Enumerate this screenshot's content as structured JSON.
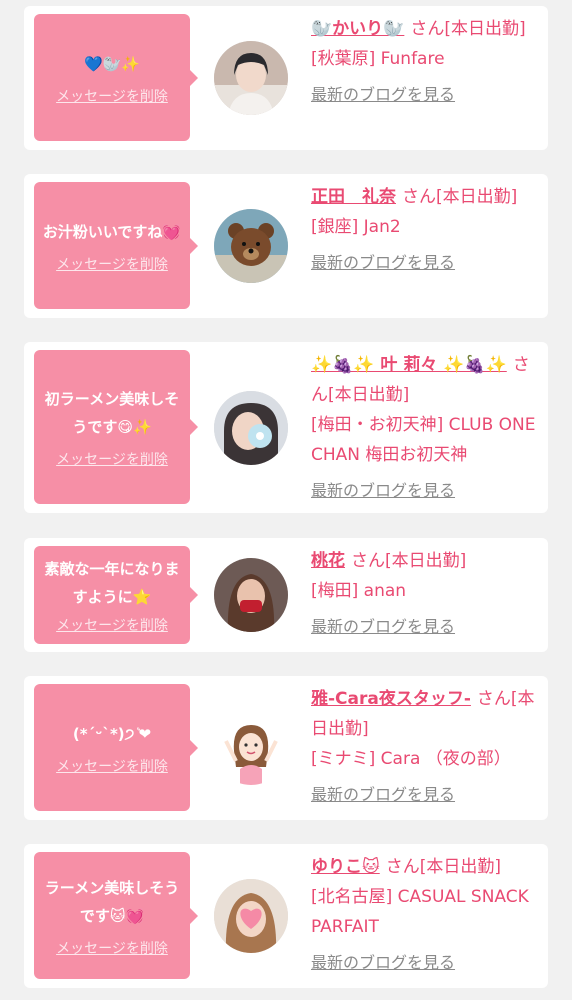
{
  "delete_label": "メッセージを削除",
  "blog_label": "最新のブログを見る",
  "cards": [
    {
      "message": "💙🦭✨",
      "name": "🦭かいり🦭",
      "suffix": "さん[本日出勤]",
      "area": "[秋葉原] Funfare",
      "avatar": "person-icon"
    },
    {
      "message": "お汁粉いいですね💓",
      "name": "正田　礼奈",
      "suffix": "さん[本日出勤]",
      "area": "[銀座] Jan2",
      "avatar": "bear-icon"
    },
    {
      "message": "初ラーメン美味しそうです😋✨",
      "name": "✨🍇✨ 叶 莉々 ✨🍇✨",
      "suffix": "さん[本日出勤]",
      "area": "[梅田・お初天神] CLUB ONE CHAN 梅田お初天神",
      "avatar": "flower-face-icon"
    },
    {
      "message": "素敵な一年になりますように⭐",
      "name": "桃花",
      "suffix": "さん[本日出勤]",
      "area": "[梅田] anan",
      "avatar": "person-icon"
    },
    {
      "message": "(*ˊᵕˋ*)੭ ͛❤",
      "name": "雅-Cara夜スタッフ-",
      "suffix": "さん[本日出勤]",
      "area": "[ミナミ] Cara （夜の部）",
      "avatar": "cartoon-girl-icon"
    },
    {
      "message": "ラーメン美味しそうです🐱💓",
      "name": "ゆりこ🐱",
      "suffix": "さん[本日出勤]",
      "area": "[北名古屋] CASUAL SNACK PARFAIT",
      "avatar": "heart-face-icon"
    }
  ]
}
